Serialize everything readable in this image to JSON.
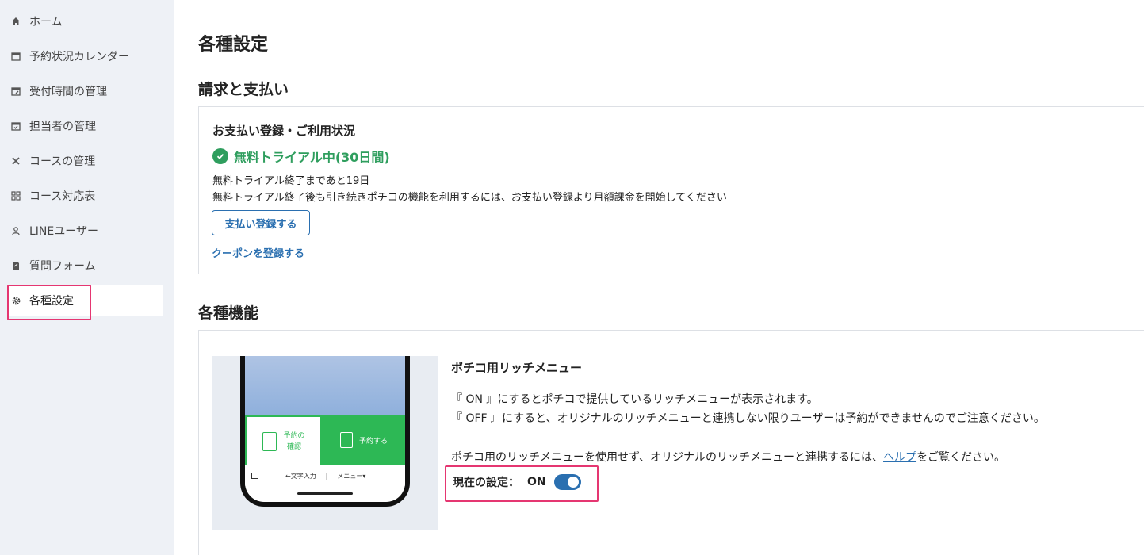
{
  "sidebar": {
    "items": [
      {
        "label": "ホーム",
        "icon": "home-icon"
      },
      {
        "label": "予約状況カレンダー",
        "icon": "calendar-icon"
      },
      {
        "label": "受付時間の管理",
        "icon": "calendar-edit-icon"
      },
      {
        "label": "担当者の管理",
        "icon": "calendar-check-icon"
      },
      {
        "label": "コースの管理",
        "icon": "utensils-icon"
      },
      {
        "label": "コース対応表",
        "icon": "grid-icon"
      },
      {
        "label": "LINEユーザー",
        "icon": "user-icon"
      },
      {
        "label": "質問フォーム",
        "icon": "form-edit-icon"
      },
      {
        "label": "各種設定",
        "icon": "gear-icon"
      }
    ],
    "active_index": 8
  },
  "page": {
    "title": "各種設定"
  },
  "billing": {
    "section_title": "請求と支払い",
    "card_heading": "お支払い登録・ご利用状況",
    "trial_status": "無料トライアル中(30日間)",
    "days_left": "無料トライアル終了まであと19日",
    "notice": "無料トライアル終了後も引き続きポチコの機能を利用するには、お支払い登録より月額課金を開始してください",
    "pay_button": "支払い登録する",
    "coupon_link": "クーポンを登録する"
  },
  "features": {
    "section_title": "各種機能",
    "rich_menu": {
      "title": "ポチコ用リッチメニュー",
      "desc_on": "『 ON 』にするとポチコで提供しているリッチメニューが表示されます。",
      "desc_off": "『 OFF 』にすると、オリジナルのリッチメニューと連携しない限りユーザーは予約ができませんのでご注意ください。",
      "help_prefix": "ポチコ用のリッチメニューを使用せず、オリジナルのリッチメニューと連携するには、",
      "help_link": "ヘルプ",
      "help_suffix": "をご覧ください。",
      "setting_label": "現在の設定：",
      "setting_value": "ON",
      "enabled": true
    },
    "preview": {
      "left_button_line1": "予約の",
      "left_button_line2": "確認",
      "right_button": "予約する",
      "bottom_input": "←文字入力",
      "bottom_menu": "メニュー▾"
    }
  },
  "colors": {
    "accent": "#2a6fb0",
    "success": "#2f9e5e",
    "line_green": "#2db855",
    "highlight": "#e53671"
  }
}
